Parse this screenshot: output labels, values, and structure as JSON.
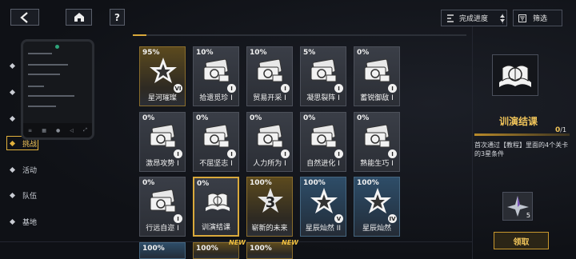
{
  "topbar": {
    "sort_label": "完成进度",
    "filter_label": "筛选",
    "help_label": "?"
  },
  "sidebar": {
    "items": [
      {
        "label": ""
      },
      {
        "label": ""
      },
      {
        "label": ""
      },
      {
        "label": "挑战"
      },
      {
        "label": "活动"
      },
      {
        "label": "队伍"
      },
      {
        "label": "基地"
      }
    ]
  },
  "progress": {
    "fraction": 0.04
  },
  "cards": [
    {
      "pct": "95%",
      "title": "星河璀璨",
      "rank": "VI",
      "style": "gold",
      "icon": "star-icon"
    },
    {
      "pct": "10%",
      "title": "拾遗觅珍 I",
      "rank": "I",
      "style": "grey",
      "icon": "camera-icon"
    },
    {
      "pct": "10%",
      "title": "贸易开采 I",
      "rank": "I",
      "style": "grey",
      "icon": "camera-icon"
    },
    {
      "pct": "5%",
      "title": "凝思裂阵 I",
      "rank": "I",
      "style": "grey",
      "icon": "camera-icon"
    },
    {
      "pct": "0%",
      "title": "蓄锐御敌 I",
      "rank": "I",
      "style": "grey",
      "icon": "camera-icon"
    },
    {
      "pct": "0%",
      "title": "激昂攻势 I",
      "rank": "I",
      "style": "grey",
      "icon": "camera-icon"
    },
    {
      "pct": "0%",
      "title": "不屈坚志 I",
      "rank": "I",
      "style": "grey",
      "icon": "camera-icon"
    },
    {
      "pct": "0%",
      "title": "人力所为 I",
      "rank": "I",
      "style": "grey",
      "icon": "camera-icon"
    },
    {
      "pct": "0%",
      "title": "自然进化 I",
      "rank": "I",
      "style": "grey",
      "icon": "camera-icon"
    },
    {
      "pct": "0%",
      "title": "熟能生巧 I",
      "rank": "I",
      "style": "grey",
      "icon": "camera-icon"
    },
    {
      "pct": "0%",
      "title": "行远自迩 I",
      "rank": "I",
      "style": "grey",
      "icon": "camera-icon"
    },
    {
      "pct": "0%",
      "title": "训演结课",
      "rank": "",
      "style": "sel",
      "icon": "book-icon"
    },
    {
      "pct": "100%",
      "title": "崭新的未来",
      "rank": "",
      "style": "gold",
      "icon": "three-icon"
    },
    {
      "pct": "100%",
      "title": "星辰灿然 II",
      "rank": "V",
      "style": "blue",
      "icon": "star-icon"
    },
    {
      "pct": "100%",
      "title": "星辰灿然",
      "rank": "IV",
      "style": "blue",
      "icon": "star-icon"
    }
  ],
  "bottom_row": [
    {
      "pct": "100%"
    },
    {
      "pct": "100%"
    },
    {
      "pct": "100%"
    }
  ],
  "new_badges": [
    "NEW",
    "NEW"
  ],
  "detail": {
    "title": "训演结课",
    "progress_current": "0",
    "progress_total": "/1",
    "description": "首次通过【教程】里面的4个关卡的3星条件",
    "reward_count": "5",
    "claim_label": "领取"
  }
}
